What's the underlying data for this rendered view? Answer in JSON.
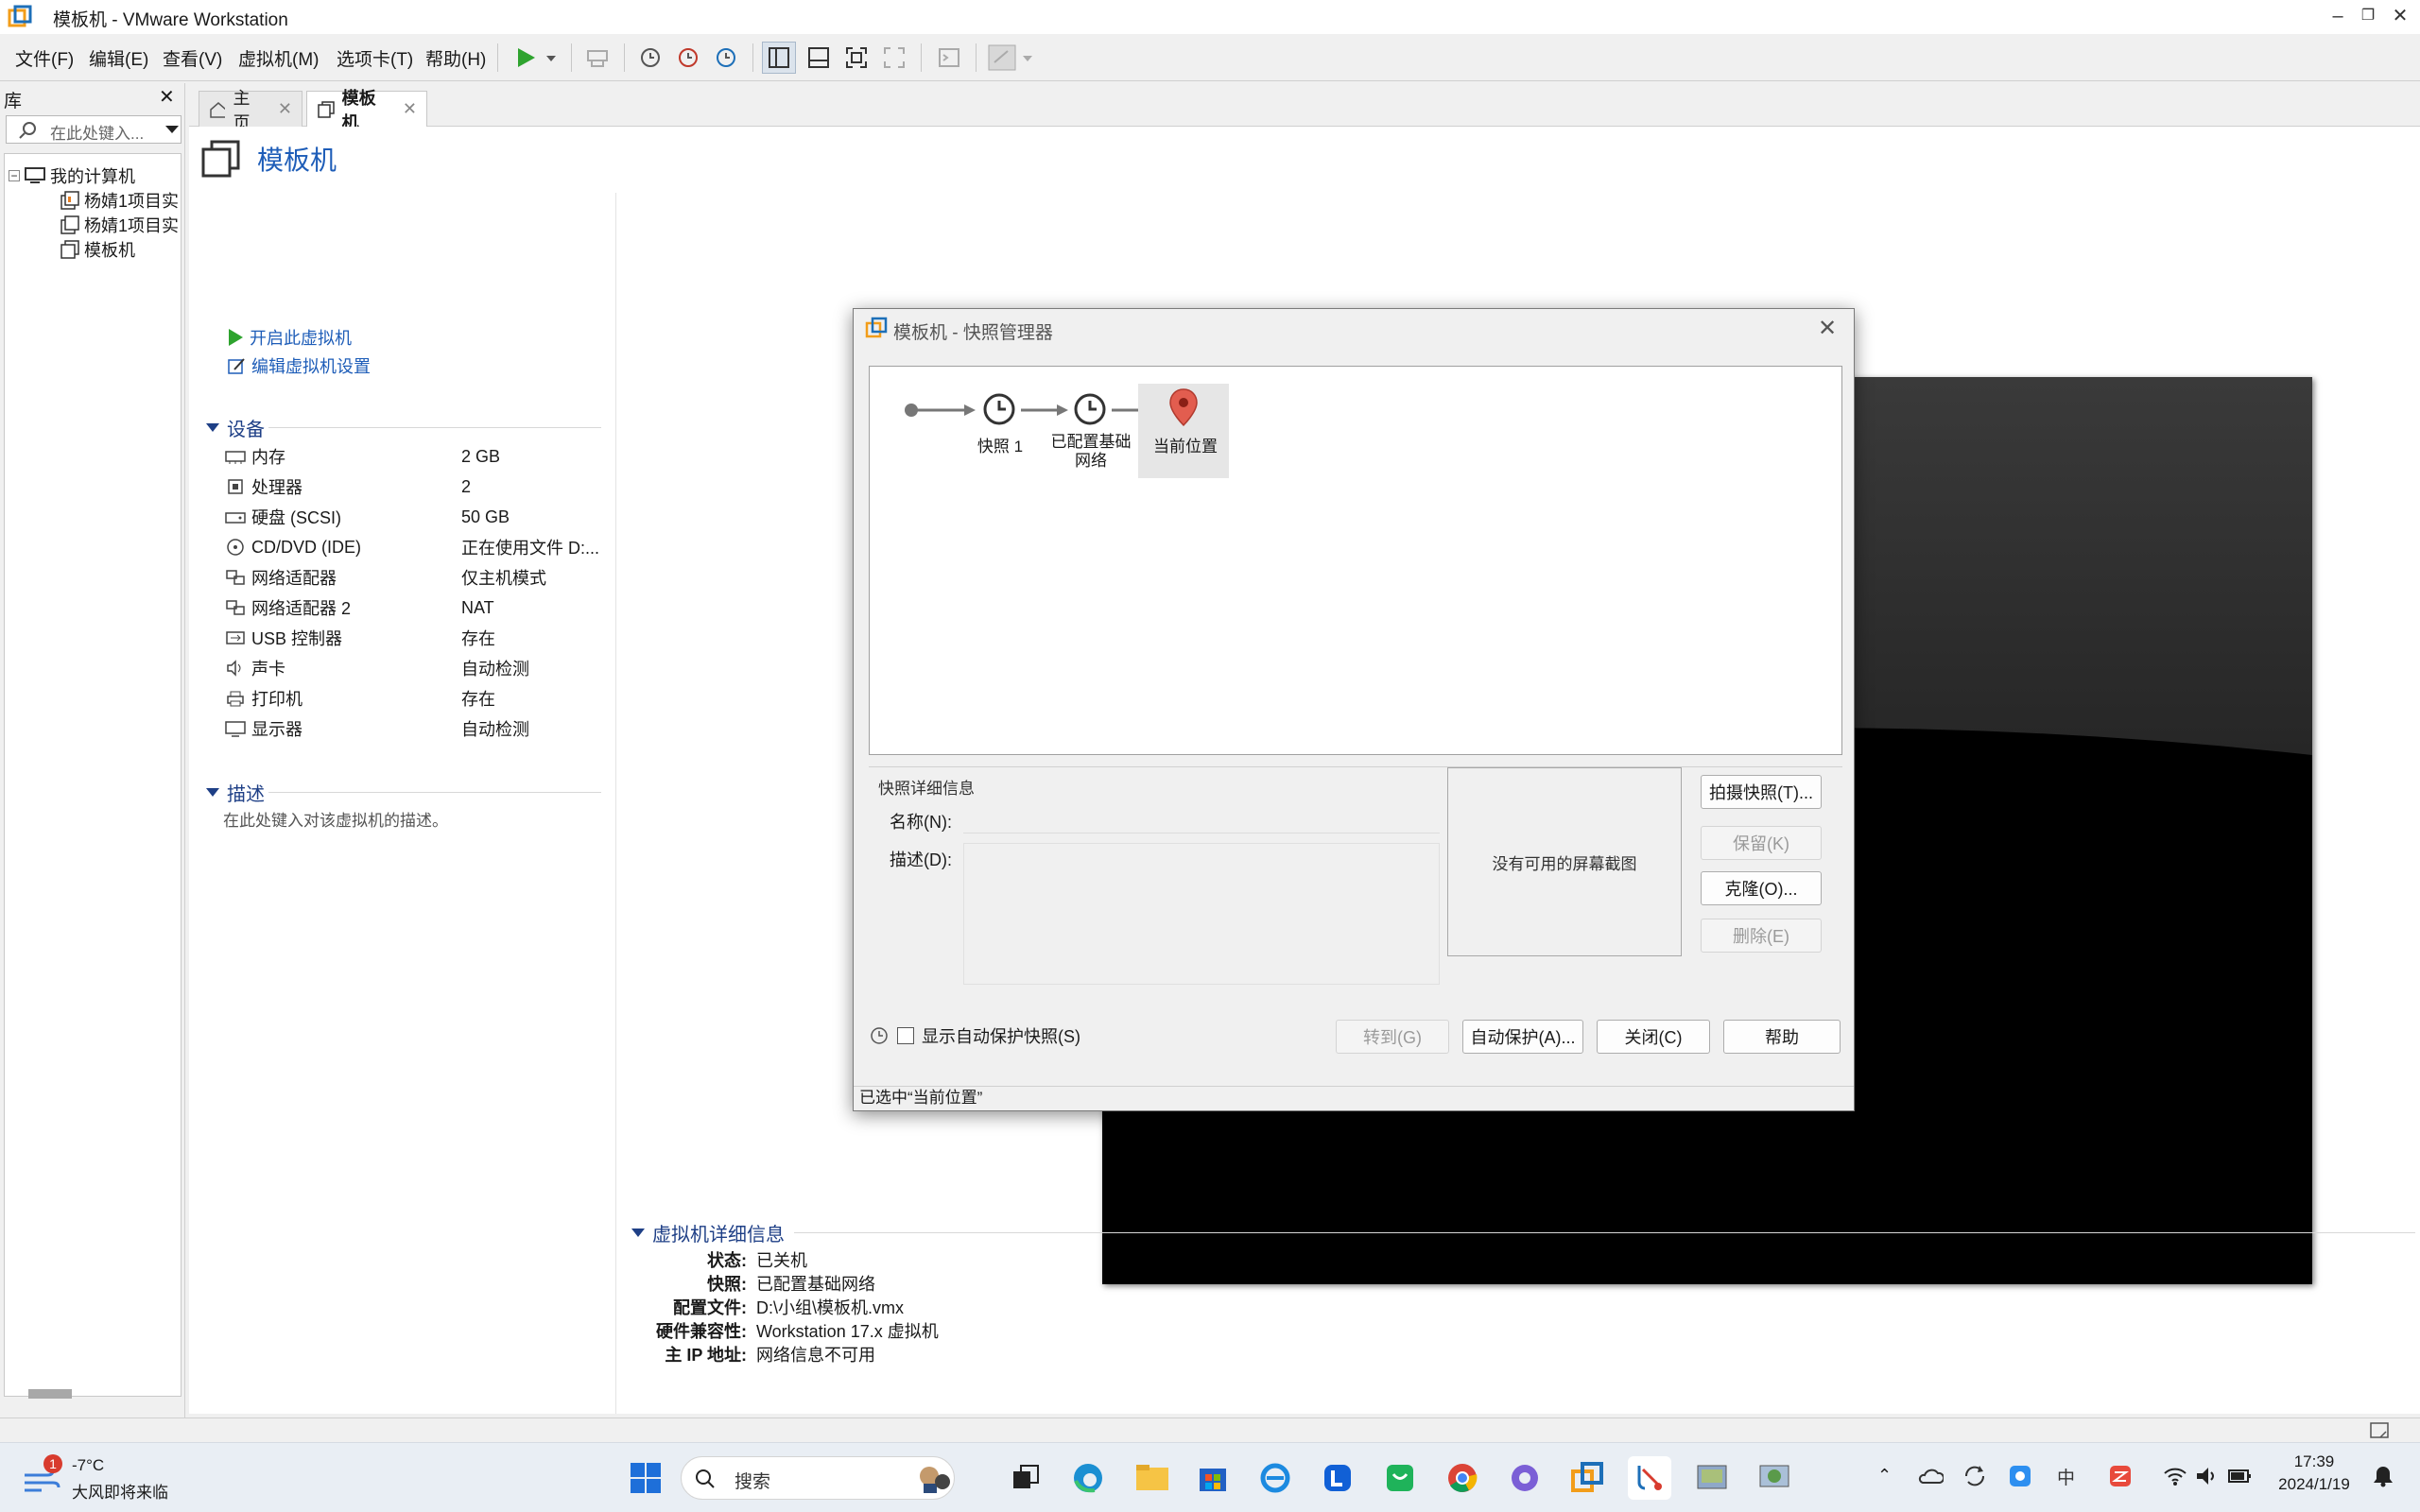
{
  "window": {
    "title": "模板机 - VMware Workstation"
  },
  "menu": [
    "文件(F)",
    "编辑(E)",
    "查看(V)",
    "虚拟机(M)",
    "选项卡(T)",
    "帮助(H)"
  ],
  "library": {
    "header": "库",
    "search_placeholder": "在此处键入...",
    "tree": {
      "root": "我的计算机",
      "items": [
        "杨婧1项目实",
        "杨婧1项目实",
        "模板机"
      ]
    }
  },
  "tabs": [
    {
      "label": "主页"
    },
    {
      "label": "模板机"
    }
  ],
  "vm": {
    "title": "模板机",
    "actions": {
      "start": "开启此虚拟机",
      "edit": "编辑虚拟机设置"
    },
    "devices_header": "设备",
    "devices": [
      {
        "name": "内存",
        "value": "2 GB",
        "icon": "memory-icon"
      },
      {
        "name": "处理器",
        "value": "2",
        "icon": "cpu-icon"
      },
      {
        "name": "硬盘 (SCSI)",
        "value": "50 GB",
        "icon": "harddisk-icon"
      },
      {
        "name": "CD/DVD (IDE)",
        "value": "正在使用文件 D:...",
        "icon": "cdrom-icon"
      },
      {
        "name": "网络适配器",
        "value": "仅主机模式",
        "icon": "network-icon"
      },
      {
        "name": "网络适配器 2",
        "value": "NAT",
        "icon": "network-icon"
      },
      {
        "name": "USB 控制器",
        "value": "存在",
        "icon": "usb-icon"
      },
      {
        "name": "声卡",
        "value": "自动检测",
        "icon": "sound-icon"
      },
      {
        "name": "打印机",
        "value": "存在",
        "icon": "printer-icon"
      },
      {
        "name": "显示器",
        "value": "自动检测",
        "icon": "display-icon"
      }
    ],
    "description_header": "描述",
    "description_placeholder": "在此处键入对该虚拟机的描述。",
    "details_header": "虚拟机详细信息",
    "details": [
      {
        "label": "状态:",
        "value": "已关机"
      },
      {
        "label": "快照:",
        "value": "已配置基础网络"
      },
      {
        "label": "配置文件:",
        "value": "D:\\小组\\模板机.vmx"
      },
      {
        "label": "硬件兼容性:",
        "value": "Workstation 17.x 虚拟机"
      },
      {
        "label": "主 IP 地址:",
        "value": "网络信息不可用"
      }
    ]
  },
  "snapshot_dialog": {
    "title": "模板机 - 快照管理器",
    "nodes": [
      "快照 1",
      "已配置基础网络",
      "当前位置"
    ],
    "details_group": "快照详细信息",
    "name_label": "名称(N):",
    "desc_label": "描述(D):",
    "no_screenshot": "没有可用的屏幕截图",
    "buttons": {
      "take": "拍摄快照(T)...",
      "keep": "保留(K)",
      "clone": "克隆(O)...",
      "delete": "删除(E)"
    },
    "show_autoprotect": "显示自动保护快照(S)",
    "bottom_buttons": {
      "goto": "转到(G)",
      "autoprotect": "自动保护(A)...",
      "close": "关闭(C)",
      "help": "帮助"
    },
    "status": "已选中“当前位置”"
  },
  "taskbar": {
    "weather": {
      "temp": "-7°C",
      "desc": "大风即将来临",
      "badge": "1"
    },
    "search_placeholder": "搜索",
    "ime": "中",
    "time": "17:39",
    "date": "2024/1/19"
  }
}
